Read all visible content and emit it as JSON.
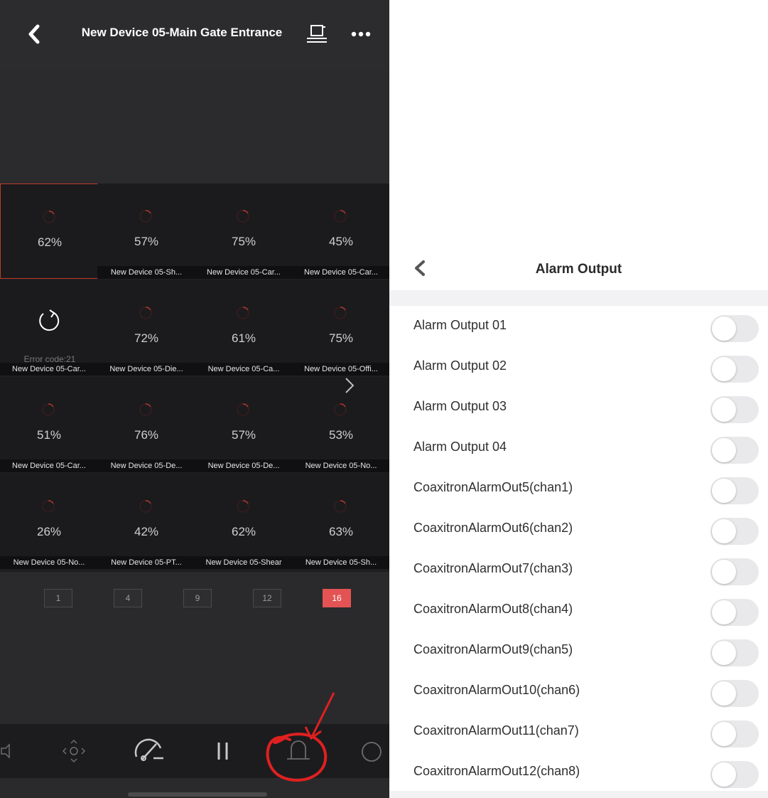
{
  "left_screen": {
    "title": "New Device 05-Main Gate Entrance",
    "cells": [
      {
        "percent": "62%",
        "label": "",
        "selected": true
      },
      {
        "percent": "57%",
        "label": "New Device 05-Sh..."
      },
      {
        "percent": "75%",
        "label": "New Device 05-Car..."
      },
      {
        "percent": "45%",
        "label": "New Device 05-Car..."
      },
      {
        "percent": "",
        "label": "New Device 05-Car...",
        "error": "Error code:21"
      },
      {
        "percent": "72%",
        "label": "New Device 05-Die..."
      },
      {
        "percent": "61%",
        "label": "New Device 05-Ca..."
      },
      {
        "percent": "75%",
        "label": "New Device 05-Offi..."
      },
      {
        "percent": "51%",
        "label": "New Device 05-Car..."
      },
      {
        "percent": "76%",
        "label": "New Device 05-De..."
      },
      {
        "percent": "57%",
        "label": "New Device 05-De..."
      },
      {
        "percent": "53%",
        "label": "New Device 05-No..."
      },
      {
        "percent": "26%",
        "label": "New Device 05-No..."
      },
      {
        "percent": "42%",
        "label": "New Device 05-PT..."
      },
      {
        "percent": "62%",
        "label": "New Device 05-Shear"
      },
      {
        "percent": "63%",
        "label": "New Device 05-Sh..."
      }
    ],
    "layout_options": [
      "1",
      "4",
      "9",
      "12",
      "16"
    ],
    "active_layout": "16",
    "toolbar_icons": [
      "audio-icon",
      "ptz-icon",
      "speedometer-icon",
      "pause-icon",
      "alarm-bell-icon",
      "record-icon"
    ],
    "accent_color": "#e45353"
  },
  "right_screen": {
    "title": "Alarm Output",
    "items": [
      {
        "label": "Alarm Output 01",
        "on": false
      },
      {
        "label": "Alarm Output 02",
        "on": false
      },
      {
        "label": "Alarm Output 03",
        "on": false
      },
      {
        "label": "Alarm Output 04",
        "on": false
      },
      {
        "label": "CoaxitronAlarmOut5(chan1)",
        "on": false
      },
      {
        "label": "CoaxitronAlarmOut6(chan2)",
        "on": false
      },
      {
        "label": "CoaxitronAlarmOut7(chan3)",
        "on": false
      },
      {
        "label": "CoaxitronAlarmOut8(chan4)",
        "on": false
      },
      {
        "label": "CoaxitronAlarmOut9(chan5)",
        "on": false
      },
      {
        "label": "CoaxitronAlarmOut10(chan6)",
        "on": false
      },
      {
        "label": "CoaxitronAlarmOut11(chan7)",
        "on": false
      },
      {
        "label": "CoaxitronAlarmOut12(chan8)",
        "on": false
      }
    ]
  }
}
